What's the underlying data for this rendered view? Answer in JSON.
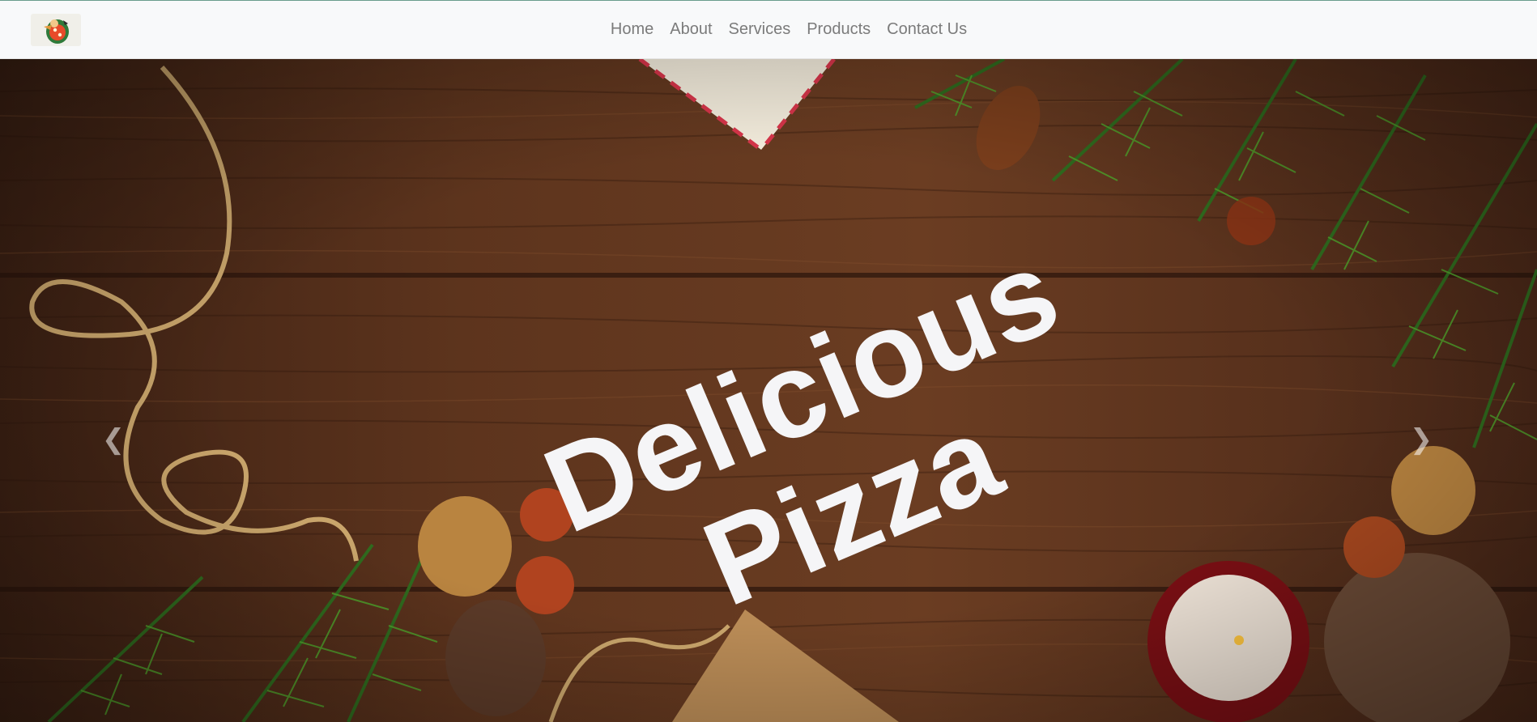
{
  "navbar": {
    "brand_icon": "pizza-mascot-logo",
    "links": [
      "Home",
      "About",
      "Services",
      "Products",
      "Contact Us"
    ]
  },
  "hero": {
    "line1": "Delicious",
    "line2": "Pizza",
    "background": "wooden table with pine branches, pinecones, nuts, twine and candle",
    "prev_icon": "chevron-left-icon",
    "next_icon": "chevron-right-icon"
  },
  "colors": {
    "wood": "#5a321c",
    "text": "#f5f5f7",
    "nav_bg": "#f8f9fa",
    "nav_text": "#7b7b7b"
  }
}
